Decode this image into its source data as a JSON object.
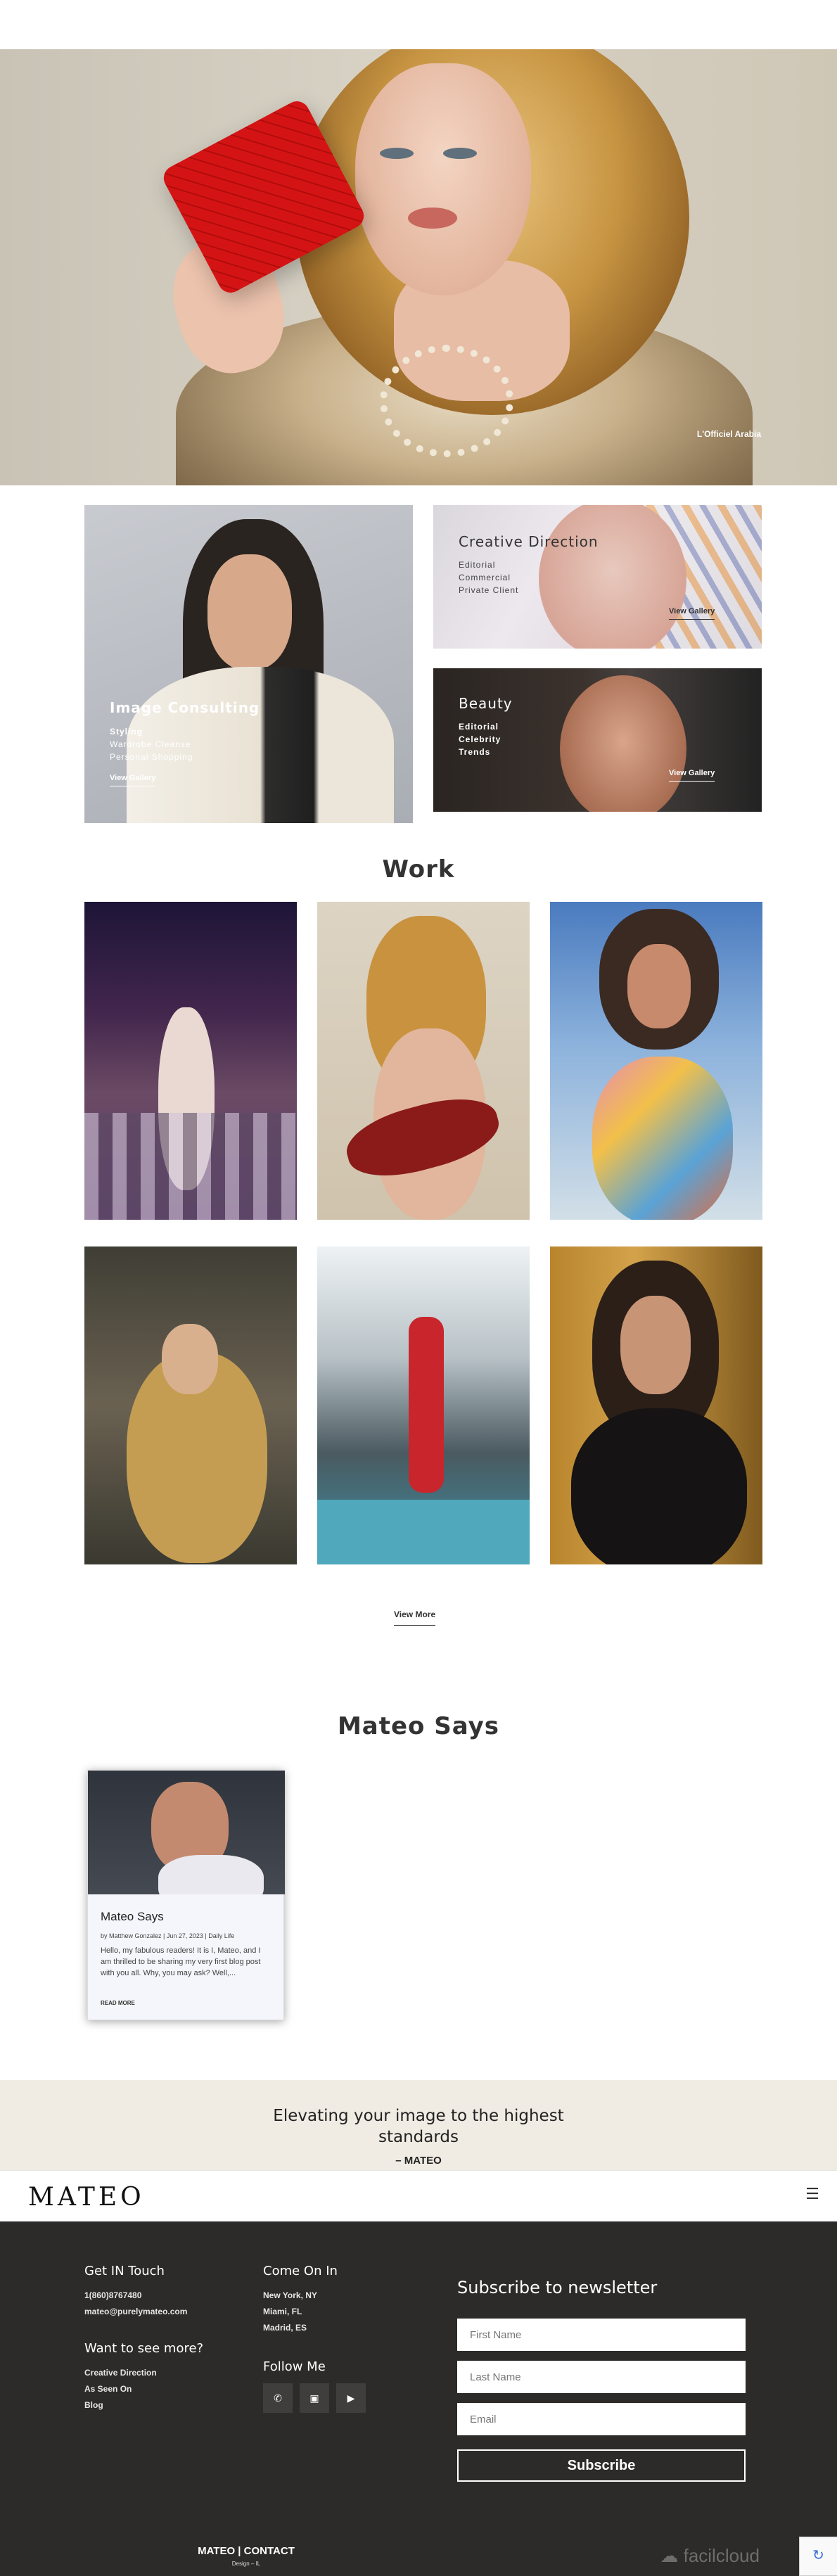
{
  "hero": {
    "caption": "L'Officiel Arabia"
  },
  "services": [
    {
      "title": "Image Consulting",
      "lines": [
        "Styling",
        "Wardrobe Cleanse",
        "Personal Shopping"
      ],
      "link": "View Gallery"
    },
    {
      "title": "Creative Direction",
      "lines": [
        "Editorial",
        "Commercial",
        "Private Client"
      ],
      "link": "View Gallery"
    },
    {
      "title": "Beauty",
      "lines": [
        "Editorial",
        "Celebrity",
        "Trends"
      ],
      "link": "View Gallery"
    }
  ],
  "work": {
    "title": "Work",
    "view_more": "View More"
  },
  "mateo_says": {
    "title": "Mateo Says",
    "post": {
      "title": "Mateo Says",
      "meta": "by Matthew Gonzalez | Jun 27, 2023 | Daily Life",
      "excerpt": "Hello, my fabulous readers! It is I, Mateo, and I am thrilled to be sharing my very first blog post with you all. Why, you may ask? Well,...",
      "read_more": "READ MORE"
    }
  },
  "quote": {
    "text": "Elevating your image to the highest standards",
    "author": "– MATEO"
  },
  "navbar": {
    "logo": "MATEO",
    "menu_icon": "☰"
  },
  "footer": {
    "get_in_touch": {
      "title": "Get IN Touch",
      "phone": "1(860)8767480",
      "email": "mateo@purelymateo.com"
    },
    "want_more": {
      "title": "Want to see more?",
      "links": [
        "Creative Direction",
        "As Seen On",
        "Blog"
      ]
    },
    "come_on_in": {
      "title": "Come On In",
      "locations": [
        "New York, NY",
        "Miami, FL",
        "Madrid, ES"
      ]
    },
    "follow_me": {
      "title": "Follow Me",
      "icons": [
        "whatsapp-icon",
        "instagram-icon",
        "youtube-icon"
      ]
    },
    "newsletter": {
      "title": "Subscribe to newsletter",
      "first_name_placeholder": "First Name",
      "last_name_placeholder": "Last Name",
      "email_placeholder": "Email",
      "button": "Subscribe"
    },
    "bottom_links": "MATEO | CONTACT",
    "credit": "Design – IL",
    "powered_by": "facilcloud"
  }
}
